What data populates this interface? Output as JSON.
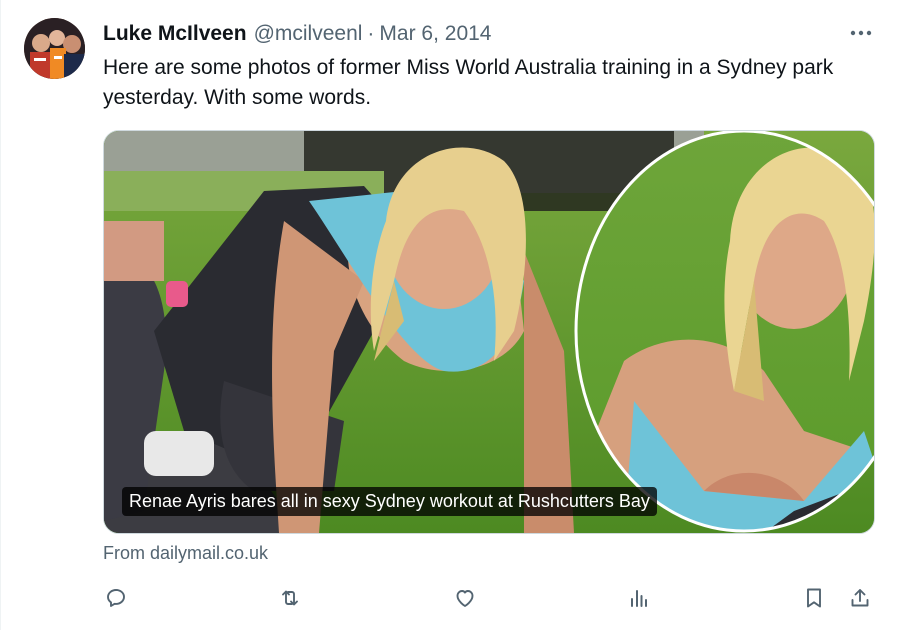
{
  "author": {
    "display_name": "Luke McIlveen",
    "handle": "@mcilveenl",
    "separator": "·",
    "date": "Mar 6, 2014",
    "avatar_icon": "profile-photo"
  },
  "tweet": {
    "text": "Here are some photos of former Miss World Australia training in a Sydney park yesterday. With some words."
  },
  "media": {
    "caption": "Renae Ayris bares all in sexy Sydney workout at Rushcutters Bay",
    "source": "From dailymail.co.uk"
  },
  "actions": {
    "icons": [
      "reply-icon",
      "retweet-icon",
      "like-icon",
      "views-icon",
      "bookmark-icon",
      "share-icon"
    ]
  },
  "colors": {
    "text_primary": "#0f1419",
    "text_secondary": "#536471",
    "border": "#cfd9de",
    "grass": "#5c8f2a",
    "top_blue": "#6ec3d8"
  }
}
